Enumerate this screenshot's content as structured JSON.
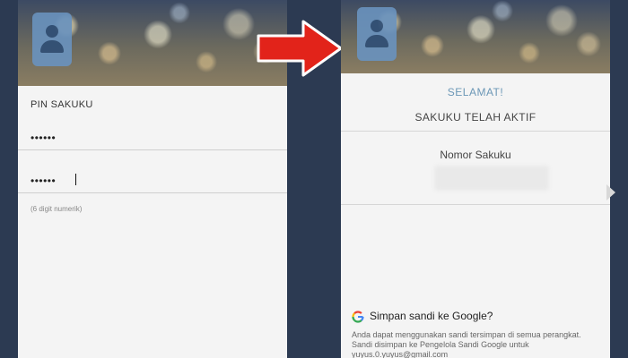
{
  "left_screen": {
    "pin_label": "PIN SAKUKU",
    "pin_value_1": "••••••",
    "pin_value_2": "••••••",
    "hint": "(6 digit numerik)"
  },
  "right_screen": {
    "headline": "SELAMAT!",
    "status": "SAKUKU TELAH AKTIF",
    "number_label": "Nomor Sakuku",
    "google_prompt": {
      "title": "Simpan sandi ke Google?",
      "description": "Anda dapat menggunakan sandi tersimpan di semua perangkat. Sandi disimpan ke Pengelola Sandi Google untuk yuyus.0.yuyus@gmail.com"
    }
  },
  "colors": {
    "arrow": "#e2231a",
    "headline": "#6b97b6",
    "background": "#2c3a52"
  }
}
